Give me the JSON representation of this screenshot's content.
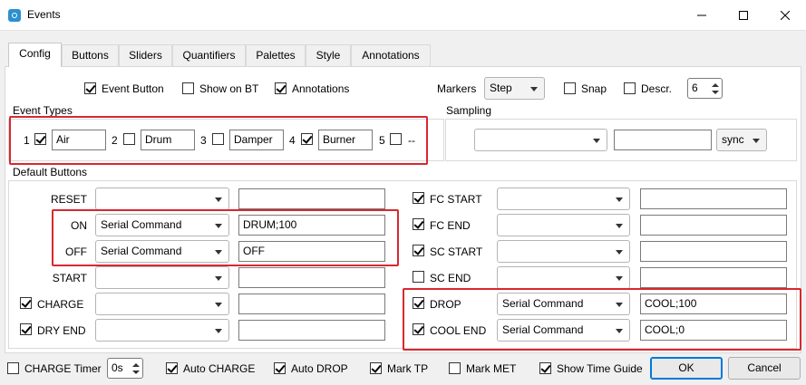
{
  "window": {
    "title": "Events",
    "controls": [
      "minimize",
      "maximize",
      "close"
    ]
  },
  "tabs": [
    "Config",
    "Buttons",
    "Sliders",
    "Quantifiers",
    "Palettes",
    "Style",
    "Annotations"
  ],
  "active_tab": "Config",
  "top_options": {
    "event_button": {
      "label": "Event Button",
      "checked": true
    },
    "show_on_bt": {
      "label": "Show on BT",
      "checked": false
    },
    "annotations": {
      "label": "Annotations",
      "checked": true
    },
    "markers_label": "Markers",
    "markers_value": "Step",
    "snap": {
      "label": "Snap",
      "checked": false
    },
    "descr": {
      "label": "Descr.",
      "checked": false
    },
    "descr_value": "6"
  },
  "event_types": {
    "title": "Event Types",
    "items": [
      {
        "num": "1",
        "checked": true,
        "name": "Air"
      },
      {
        "num": "2",
        "checked": false,
        "name": "Drum"
      },
      {
        "num": "3",
        "checked": false,
        "name": "Damper"
      },
      {
        "num": "4",
        "checked": true,
        "name": "Burner"
      },
      {
        "num": "5",
        "checked": false,
        "name": "--"
      }
    ]
  },
  "sampling": {
    "title": "Sampling",
    "combo_value": "",
    "field_value": "",
    "sync_label": "sync"
  },
  "default_buttons": {
    "title": "Default Buttons",
    "left": [
      {
        "label": "RESET",
        "has_checkbox": false,
        "checked": false,
        "action": "",
        "command": ""
      },
      {
        "label": "ON",
        "has_checkbox": false,
        "checked": false,
        "action": "Serial Command",
        "command": "DRUM;100"
      },
      {
        "label": "OFF",
        "has_checkbox": false,
        "checked": false,
        "action": "Serial Command",
        "command": "OFF"
      },
      {
        "label": "START",
        "has_checkbox": false,
        "checked": false,
        "action": "",
        "command": ""
      },
      {
        "label": "CHARGE",
        "has_checkbox": true,
        "checked": true,
        "action": "",
        "command": ""
      },
      {
        "label": "DRY END",
        "has_checkbox": true,
        "checked": true,
        "action": "",
        "command": ""
      }
    ],
    "right": [
      {
        "label": "FC START",
        "checked": true,
        "action": "",
        "command": ""
      },
      {
        "label": "FC END",
        "checked": true,
        "action": "",
        "command": ""
      },
      {
        "label": "SC START",
        "checked": true,
        "action": "",
        "command": ""
      },
      {
        "label": "SC END",
        "checked": false,
        "action": "",
        "command": ""
      },
      {
        "label": "DROP",
        "checked": true,
        "action": "Serial Command",
        "command": "COOL;100"
      },
      {
        "label": "COOL END",
        "checked": true,
        "action": "Serial Command",
        "command": "COOL;0"
      }
    ]
  },
  "bottom_bar": {
    "charge_timer": {
      "label": "CHARGE Timer",
      "checked": false
    },
    "charge_timer_value": "0s",
    "auto_charge": {
      "label": "Auto CHARGE",
      "checked": true
    },
    "auto_drop": {
      "label": "Auto DROP",
      "checked": true
    },
    "mark_tp": {
      "label": "Mark TP",
      "checked": true
    },
    "mark_met": {
      "label": "Mark MET",
      "checked": false
    },
    "show_time_guide": {
      "label": "Show Time Guide",
      "checked": true
    },
    "ok_label": "OK",
    "cancel_label": "Cancel"
  },
  "highlight_color": "#d7282f",
  "accent_color": "#0078d7"
}
